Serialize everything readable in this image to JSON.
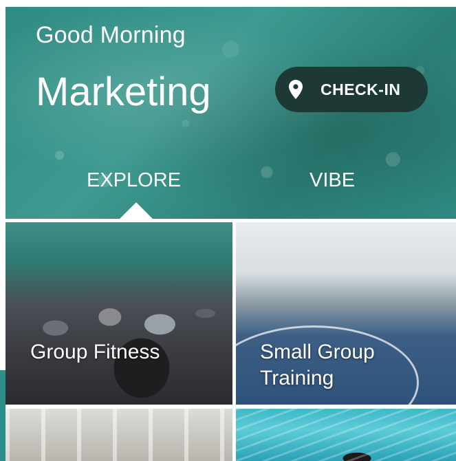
{
  "header": {
    "greeting": "Good Morning",
    "user_name": "Marketing",
    "checkin_label": "CHECK-IN",
    "checkin_icon": "location-pin-icon"
  },
  "tabs": [
    {
      "label": "EXPLORE",
      "selected": true
    },
    {
      "label": "VIBE",
      "selected": false
    }
  ],
  "tiles": [
    {
      "label": "Group Fitness"
    },
    {
      "label_line1": "Small Group",
      "label_line2": "Training"
    },
    {
      "label": ""
    },
    {
      "label": ""
    }
  ],
  "colors": {
    "hero_teal": "#2f8c82",
    "checkin_bg": "#1d3835",
    "text_on_image": "#ffffff"
  }
}
